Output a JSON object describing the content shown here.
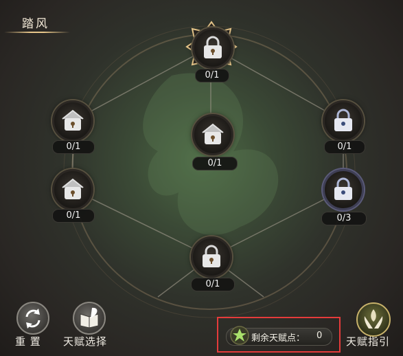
{
  "title": "踏风",
  "nodes": [
    {
      "id": "top",
      "count": "0/1",
      "icon": "lock-icon",
      "state": "highlighted"
    },
    {
      "id": "left-upper",
      "count": "0/1",
      "icon": "lock-icon"
    },
    {
      "id": "center",
      "count": "0/1",
      "icon": "lock-icon"
    },
    {
      "id": "right-upper",
      "count": "0/1",
      "icon": "lock-icon"
    },
    {
      "id": "left-lower",
      "count": "0/1",
      "icon": "lock-icon"
    },
    {
      "id": "right-lower",
      "count": "0/3",
      "icon": "lock-icon"
    },
    {
      "id": "bottom",
      "count": "0/1",
      "icon": "lock-icon"
    }
  ],
  "bottom_bar": {
    "reset_label": "重 置",
    "talent_select_label": "天赋选择",
    "remaining_points_label": "剩余天赋点：",
    "remaining_points_value": "0",
    "talent_guide_label": "天赋指引"
  },
  "colors": {
    "highlight_gold": "#e7c68a",
    "frame_red": "#e53b3b"
  }
}
